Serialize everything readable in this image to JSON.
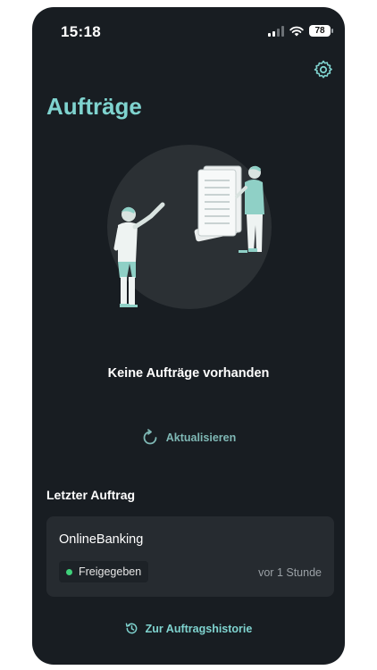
{
  "status_bar": {
    "time": "15:18",
    "battery": "78",
    "icons": [
      "signal-icon",
      "wifi-icon",
      "battery-icon"
    ]
  },
  "header": {
    "title": "Aufträge",
    "settings_icon": "gear-icon"
  },
  "empty_state": {
    "message": "Keine Aufträge vorhanden",
    "refresh_label": "Aktualisieren",
    "refresh_icon": "refresh-icon"
  },
  "last_order": {
    "section_label": "Letzter Auftrag",
    "title": "OnlineBanking",
    "status": "Freigegeben",
    "status_color": "#3fd17a",
    "time": "vor 1 Stunde"
  },
  "footer": {
    "history_label": "Zur Auftragshistorie",
    "history_icon": "history-icon"
  },
  "colors": {
    "background": "#181d22",
    "accent": "#7fd3cf",
    "card": "#262b30"
  }
}
